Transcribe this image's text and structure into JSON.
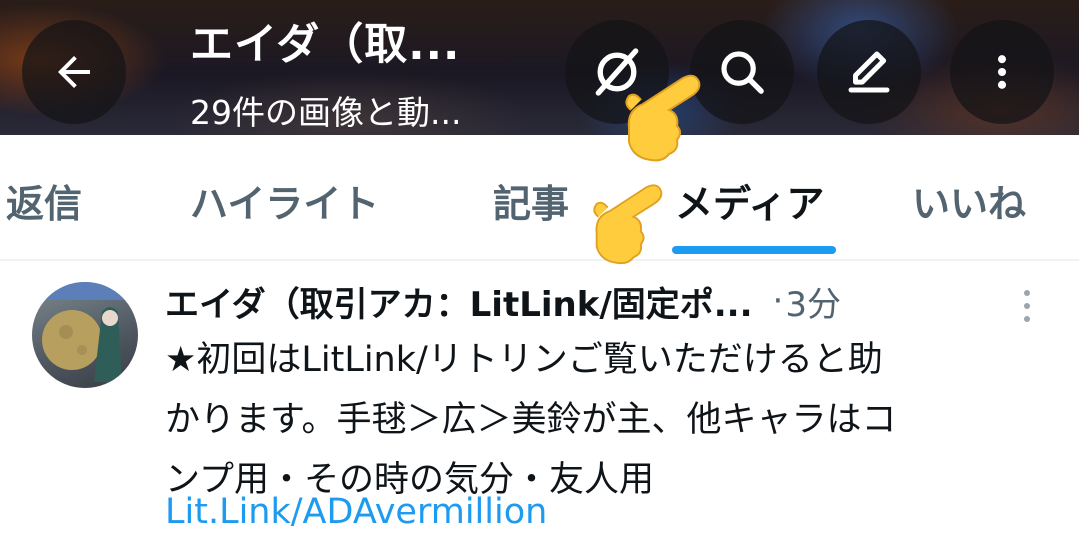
{
  "header": {
    "title": "エイダ（取...",
    "subtitle": "29件の画像と動...",
    "back_icon": "arrow-left-icon",
    "grok_icon": "grok-icon",
    "search_icon": "search-icon",
    "compose_icon": "pencil-icon",
    "more_icon": "more-vertical-icon"
  },
  "tabs": [
    {
      "label": "返信"
    },
    {
      "label": "ハイライト"
    },
    {
      "label": "記事"
    },
    {
      "label": "メディア",
      "active": true
    },
    {
      "label": "いいね"
    }
  ],
  "post": {
    "display_name": "エイダ（取引アカ：LitLink/固定ポ...",
    "separator": "·",
    "time": "3分",
    "text": "★初回はLitLink/リトリンご覧いただけると助\nかります。手毬＞広＞美鈴が主、他キャラはコ\nンプ用・その時の気分・友人用",
    "link": "Lit.Link/ADAvermillion"
  },
  "colors": {
    "accent": "#1d9bf0",
    "text_primary": "#0f1419",
    "text_secondary": "#536471"
  }
}
